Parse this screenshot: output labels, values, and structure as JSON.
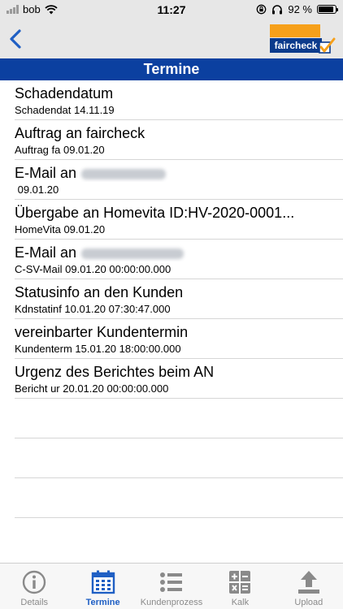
{
  "status": {
    "carrier": "bob",
    "time": "11:27",
    "battery": "92 %",
    "battery_level": 0.92
  },
  "nav": {
    "logo_text": "faircheck"
  },
  "title": "Termine",
  "items": [
    {
      "title": "Schadendatum",
      "subtitle": "Schadendat 14.11.19"
    },
    {
      "title": "Auftrag an faircheck",
      "subtitle": "Auftrag fa 09.01.20"
    },
    {
      "title": "E-Mail an",
      "subtitle": " 09.01.20"
    },
    {
      "title": "Übergabe an Homevita ID:HV-2020-0001...",
      "subtitle": "HomeVita 09.01.20"
    },
    {
      "title": "E-Mail an",
      "subtitle": "C-SV-Mail 09.01.20 00:00:00.000"
    },
    {
      "title": "Statusinfo an den Kunden",
      "subtitle": "Kdnstatinf 10.01.20 07:30:47.000"
    },
    {
      "title": "vereinbarter Kundentermin",
      "subtitle": "Kundenterm 15.01.20 18:00:00.000"
    },
    {
      "title": "Urgenz des Berichtes beim AN",
      "subtitle": "Bericht ur 20.01.20 00:00:00.000"
    }
  ],
  "tabs": [
    {
      "label": "Details",
      "icon": "info-icon"
    },
    {
      "label": "Termine",
      "icon": "calendar-icon"
    },
    {
      "label": "Kundenprozess",
      "icon": "list-icon"
    },
    {
      "label": "Kalk",
      "icon": "calculator-icon"
    },
    {
      "label": "Upload",
      "icon": "upload-icon"
    }
  ],
  "colors": {
    "accent": "#0b40a0",
    "active_tab": "#1f5fc4",
    "logo_orange": "#f6a01a"
  }
}
